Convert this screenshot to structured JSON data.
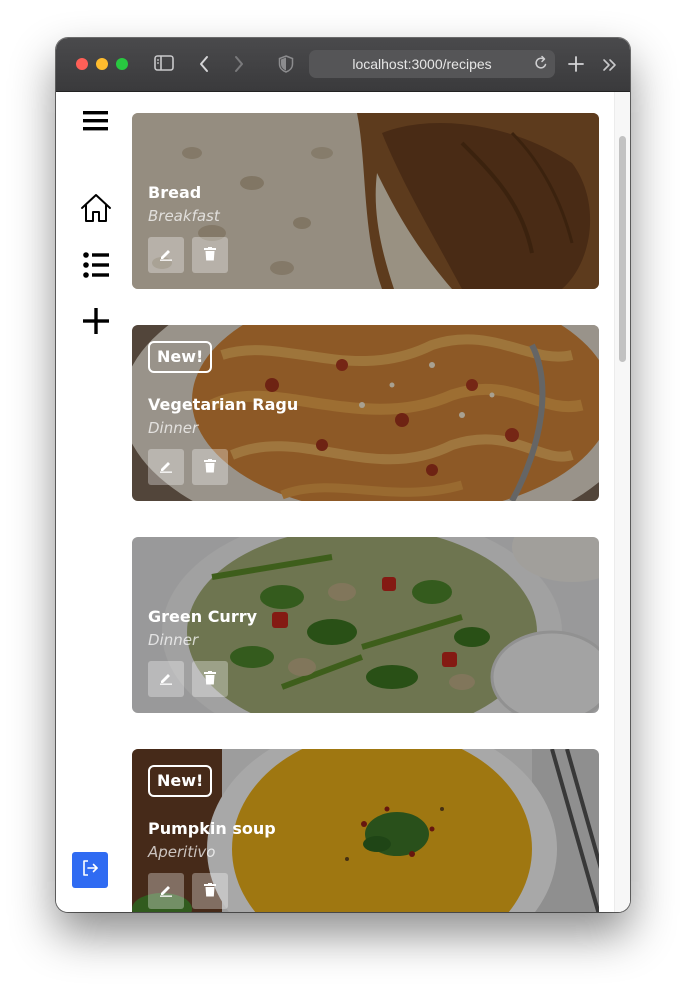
{
  "browser": {
    "url": "localhost:3000/recipes"
  },
  "sidebar": {
    "icons": [
      "menu-icon",
      "home-icon",
      "list-icon",
      "add-icon"
    ],
    "logout_icon": "logout-icon",
    "accent_color": "#2f6bf2"
  },
  "recipes": [
    {
      "title": "Bread",
      "category": "Breakfast",
      "badge": "",
      "image": "bread"
    },
    {
      "title": "Vegetarian Ragu",
      "category": "Dinner",
      "badge": "New!",
      "image": "pasta"
    },
    {
      "title": "Green Curry",
      "category": "Dinner",
      "badge": "",
      "image": "curry"
    },
    {
      "title": "Pumpkin soup",
      "category": "Aperitivo",
      "badge": "New!",
      "image": "soup"
    }
  ]
}
